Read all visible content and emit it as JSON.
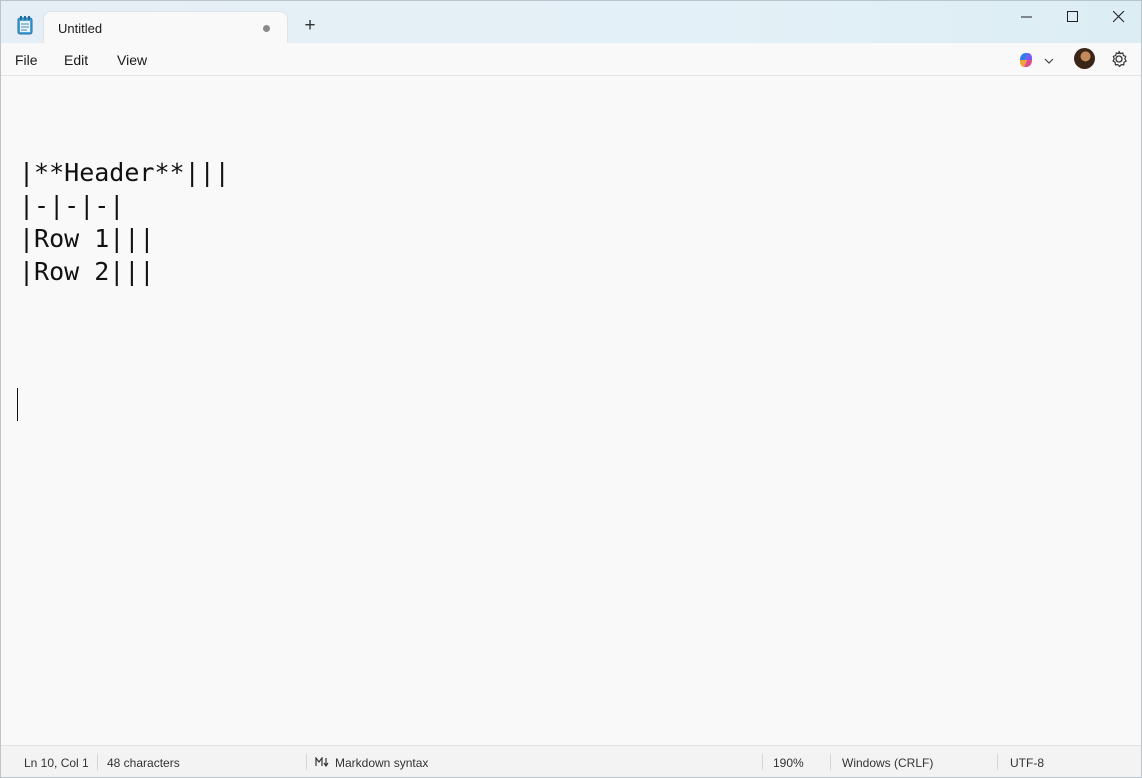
{
  "tab": {
    "title": "Untitled"
  },
  "menu": {
    "file": "File",
    "edit": "Edit",
    "view": "View"
  },
  "editor": {
    "lines": [
      "|**Header**|||",
      "|-|-|-|",
      "|Row 1|||",
      "|Row 2|||"
    ]
  },
  "status": {
    "position": "Ln 10, Col 1",
    "characters": "48 characters",
    "format": "Markdown syntax",
    "zoom": "190%",
    "line_ending": "Windows (CRLF)",
    "encoding": "UTF-8"
  }
}
